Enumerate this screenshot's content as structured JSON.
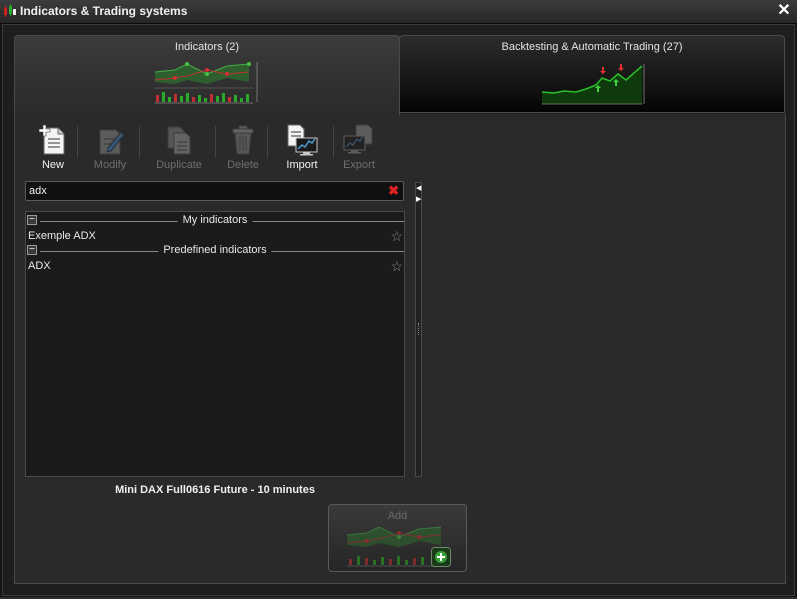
{
  "window": {
    "title": "Indicators & Trading systems",
    "close_symbol": "✕"
  },
  "tabs": [
    {
      "label": "Indicators (2)",
      "active": true
    },
    {
      "label": "Backtesting & Automatic Trading (27)",
      "active": false
    }
  ],
  "toolbar": [
    {
      "label": "New",
      "enabled": true,
      "icon": "new-document-icon"
    },
    {
      "label": "Modify",
      "enabled": false,
      "icon": "edit-icon"
    },
    {
      "label": "Duplicate",
      "enabled": false,
      "icon": "duplicate-icon"
    },
    {
      "label": "Delete",
      "enabled": false,
      "icon": "trash-icon"
    },
    {
      "label": "Import",
      "enabled": true,
      "icon": "import-icon"
    },
    {
      "label": "Export",
      "enabled": false,
      "icon": "export-icon"
    }
  ],
  "search": {
    "value": "adx",
    "clear_symbol": "✖"
  },
  "groups": [
    {
      "label": "My indicators",
      "items": [
        {
          "label": "Exemple ADX"
        }
      ]
    },
    {
      "label": "Predefined indicators",
      "items": [
        {
          "label": "ADX"
        }
      ]
    }
  ],
  "instrument": "Mini DAX Full0616 Future - 10 minutes",
  "add_button": {
    "label": "Add",
    "enabled": false
  },
  "colors": {
    "accent_green": "#1fa01f",
    "marker_red": "#d02020",
    "background": "#1e1e1e"
  }
}
